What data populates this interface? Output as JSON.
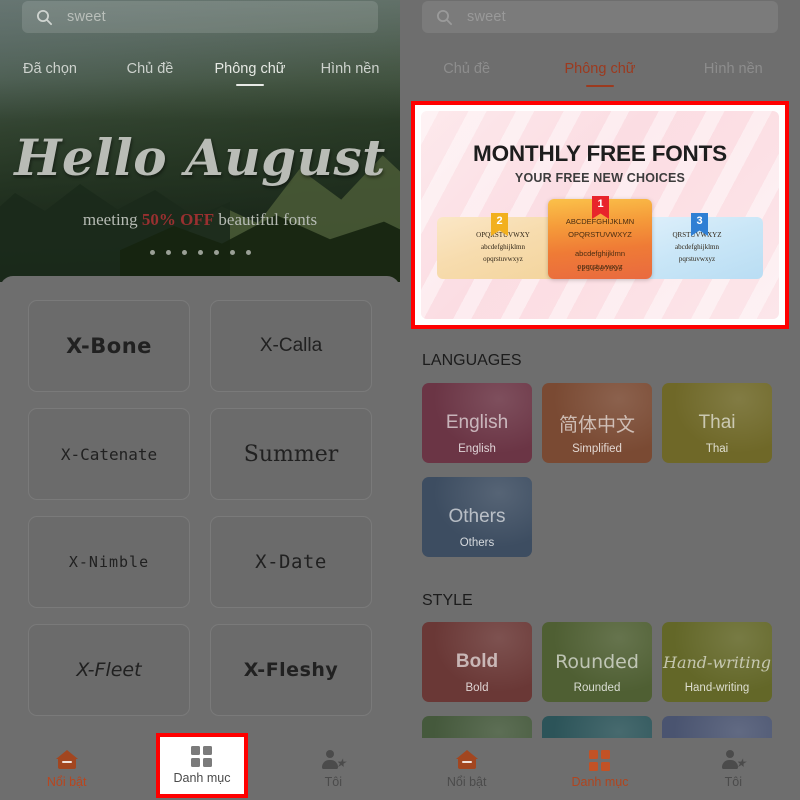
{
  "left": {
    "search": {
      "value": "sweet",
      "placeholder": "Search",
      "icon": "search-icon"
    },
    "tabs": [
      {
        "label": "Đã chọn",
        "active": false
      },
      {
        "label": "Chủ đề",
        "active": false
      },
      {
        "label": "Phông chữ",
        "active": true
      },
      {
        "label": "Hình nền",
        "active": false
      }
    ],
    "hero": {
      "title": "Hello August",
      "sub_before": "meeting",
      "sub_promo": "50% OFF",
      "sub_after": "beautiful fonts",
      "carousel_dots": 7,
      "active_dot_index": 3
    },
    "fonts": [
      {
        "name": "X-Bone"
      },
      {
        "name": "X-Calla"
      },
      {
        "name": "X-Catenate"
      },
      {
        "name": "Summer"
      },
      {
        "name": "X-Nimble"
      },
      {
        "name": "X-Date"
      },
      {
        "name": "X-Fleet"
      },
      {
        "name": "X-Fleshy"
      }
    ],
    "nav": [
      {
        "label": "Nổi bật",
        "icon": "home-icon",
        "active": true
      },
      {
        "label": "Danh mục",
        "icon": "grid-icon",
        "active": false
      },
      {
        "label": "Tôi",
        "icon": "profile-star-icon",
        "active": false
      }
    ]
  },
  "right": {
    "search": {
      "value": "sweet",
      "placeholder": "Search",
      "icon": "search-icon"
    },
    "tabs": [
      {
        "label": "Chủ đề",
        "active": false
      },
      {
        "label": "Phông chữ",
        "active": true
      },
      {
        "label": "Hình nền",
        "active": false
      }
    ],
    "promo": {
      "title": "MONTHLY FREE FONTS",
      "subtitle": "YOUR FREE NEW CHOICES",
      "cards": [
        {
          "rank": "2",
          "line1": "OPQRSTUVWXY",
          "line2": "abcdefghijklmn",
          "line3": "opqrstuvwxyz"
        },
        {
          "rank": "1",
          "line1": "ABCDEFGHIJKLMN",
          "line2": "OPQRSTUVWXYZ",
          "line3": "abcdefghijklmn",
          "line4": "opqrstuvwxyz",
          "pips": "1234567890"
        },
        {
          "rank": "3",
          "line1": "QRSTUVWXYZ",
          "line2": "abcdefghijklmn",
          "line3": "pqrstuvwxyz"
        }
      ]
    },
    "sections": [
      {
        "heading": "LANGUAGES",
        "cards": [
          {
            "big": "English",
            "small": "English",
            "color": "#6b3545"
          },
          {
            "big": "简体中文",
            "small": "Simplified",
            "color": "#7a4a33"
          },
          {
            "big": "Thai",
            "small": "Thai",
            "color": "#6f6828"
          },
          {
            "big": "Others",
            "small": "Others",
            "color": "#3d4d61"
          }
        ]
      },
      {
        "heading": "STYLE",
        "cards": [
          {
            "big": "Bold",
            "small": "Bold",
            "color": "#6a3836"
          },
          {
            "big": "Rounded",
            "small": "Rounded",
            "color": "#4f5f33"
          },
          {
            "big": "Hand-writing",
            "small": "Hand-writing",
            "color": "#636728"
          },
          {
            "big": "",
            "small": "",
            "color": "#45593c"
          },
          {
            "big": "",
            "small": "",
            "color": "#2c5459"
          },
          {
            "big": "",
            "small": "",
            "color": "#4a5470"
          }
        ]
      }
    ],
    "nav": [
      {
        "label": "Nổi bật",
        "icon": "home-icon",
        "active": false
      },
      {
        "label": "Danh mục",
        "icon": "grid-icon",
        "active": true
      },
      {
        "label": "Tôi",
        "icon": "profile-star-icon",
        "active": false
      }
    ]
  },
  "annotations": {
    "highlight_color": "#ff0000"
  }
}
